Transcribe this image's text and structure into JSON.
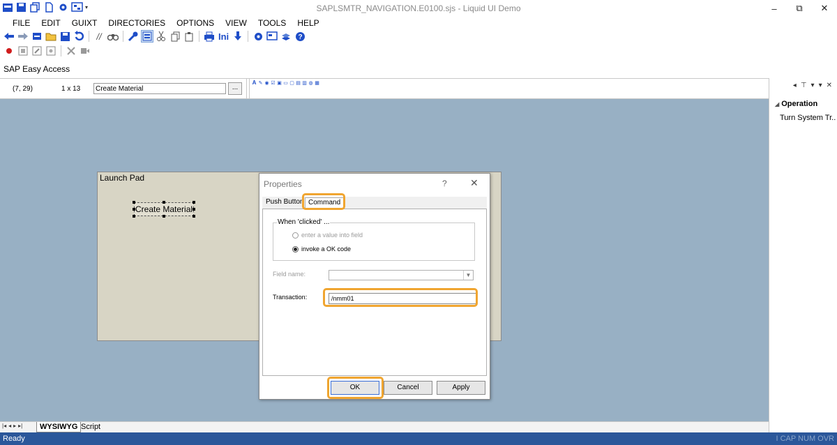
{
  "window": {
    "title": "SAPLSMTR_NAVIGATION.E0100.sjs - Liquid UI Demo",
    "controls": {
      "minimize": "–",
      "restore": "⧉",
      "close": "✕"
    }
  },
  "menu": [
    "FILE",
    "EDIT",
    "GUIXT",
    "DIRECTORIES",
    "OPTIONS",
    "VIEW",
    "TOOLS",
    "HELP"
  ],
  "toolbar": {
    "ini_label": "Ini"
  },
  "screen_title": "SAP Easy Access",
  "editor": {
    "position": "(7, 29)",
    "size": "1 x 13",
    "label_value": "Create Material",
    "browse_label": "..."
  },
  "launchpad": {
    "title": "Launch Pad",
    "button_label": "Create Material"
  },
  "dialog": {
    "title": "Properties",
    "help": "?",
    "close": "✕",
    "tabs": [
      "Push Button",
      "Command"
    ],
    "active_tab": "Command",
    "group_title": "When 'clicked' ...",
    "radio_options": [
      {
        "label": "enter a value into field",
        "checked": false,
        "enabled": false
      },
      {
        "label": "invoke a OK code",
        "checked": true,
        "enabled": true
      }
    ],
    "field_name_label": "Field name:",
    "transaction_label": "Transaction:",
    "transaction_value": "/nmm01",
    "buttons": {
      "ok": "OK",
      "cancel": "Cancel",
      "apply": "Apply"
    }
  },
  "right_panel": {
    "node": "Operation",
    "child": "Turn System Tr..."
  },
  "bottom_tabs": [
    "WYSIWYG",
    "Script"
  ],
  "status": {
    "left": "Ready",
    "right": "I CAP NUM OVR"
  },
  "colors": {
    "canvas": "#98b0c4",
    "launchpad": "#d8d5c5",
    "highlight": "#f0a530",
    "statusbar": "#2b579a",
    "accent": "#1f4ec8"
  }
}
